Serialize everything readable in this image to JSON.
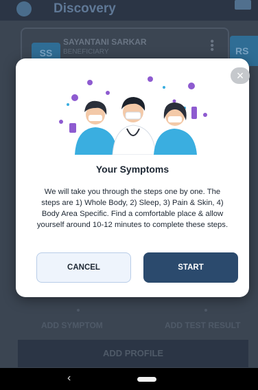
{
  "background": {
    "app_title": "Discovery",
    "profile_card": {
      "avatar_initials": "SS",
      "name": "SAYANTANI SARKAR",
      "role": "BENEFICIARY"
    },
    "second_avatar_initials": "RS",
    "actions": [
      "ADD SYMPTOM",
      "ADD TEST RESULT"
    ],
    "add_profile_label": "ADD PROFILE"
  },
  "modal": {
    "title": "Your Symptoms",
    "body": "We will take you through the steps one by one. The steps are 1) Whole Body, 2) Sleep, 3) Pain & Skin, 4) Body Area Specific. Find a comfortable place & allow yourself around 10-12 minutes to complete these steps.",
    "close_icon": "×",
    "cancel_label": "CANCEL",
    "start_label": "START"
  },
  "navbar": {
    "back_icon": "‹"
  },
  "colors": {
    "primary": "#2b4a6d",
    "overlay": "#3b4552",
    "virus": "#8e5bd0",
    "scrubs": "#3aaee0"
  }
}
